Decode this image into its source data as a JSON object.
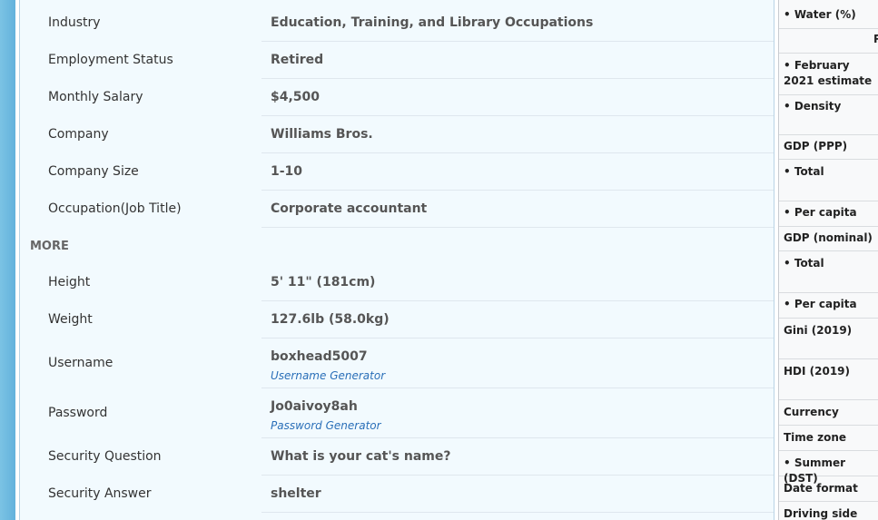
{
  "details": {
    "rows": [
      {
        "label": "Industry",
        "value": "Education, Training, and Library Occupations"
      },
      {
        "label": "Employment Status",
        "value": "Retired"
      },
      {
        "label": "Monthly Salary",
        "value": "$4,500"
      },
      {
        "label": "Company",
        "value": "Williams Bros."
      },
      {
        "label": "Company Size",
        "value": "1-10"
      },
      {
        "label": "Occupation(Job Title)",
        "value": "Corporate accountant"
      }
    ],
    "more_heading": "MORE",
    "more_rows": [
      {
        "label": "Height",
        "value": "5' 11\" (181cm)"
      },
      {
        "label": "Weight",
        "value": "127.6lb (58.0kg)"
      },
      {
        "label": "Username",
        "value": "boxhead5007",
        "link": "Username Generator"
      },
      {
        "label": "Password",
        "value": "Jo0aivoy8ah",
        "link": "Password Generator"
      },
      {
        "label": "Security Question",
        "value": "What is your cat's name?"
      },
      {
        "label": "Security Answer",
        "value": "shelter"
      }
    ]
  },
  "infobox": {
    "items": [
      "• Water (%)",
      "",
      "• February 2021 estimate",
      "• Density",
      "GDP (PPP)",
      "• Total",
      "• Per capita",
      "GDP (nominal)",
      "• Total",
      "• Per capita",
      "Gini (2019)",
      "HDI (2019)",
      "Currency",
      "Time zone",
      "• Summer (DST)",
      "Date format",
      "Driving side"
    ],
    "fragment": "P"
  }
}
